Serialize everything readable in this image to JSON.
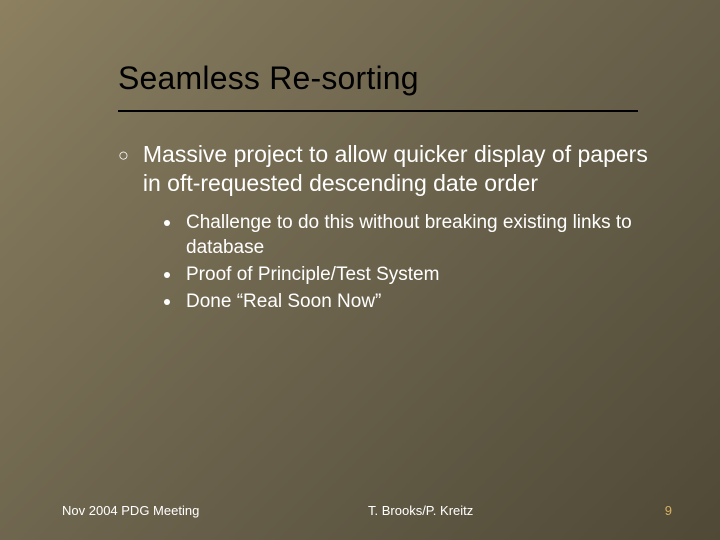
{
  "title": "Seamless Re-sorting",
  "bullets": {
    "main": "Massive project to allow quicker display of papers in oft-requested descending date order",
    "subs": [
      "Challenge to do this without breaking existing links to database",
      "Proof of Principle/Test System",
      "Done “Real Soon Now”"
    ]
  },
  "footer": {
    "left": "Nov 2004 PDG Meeting",
    "center": "T. Brooks/P. Kreitz",
    "page": "9"
  }
}
